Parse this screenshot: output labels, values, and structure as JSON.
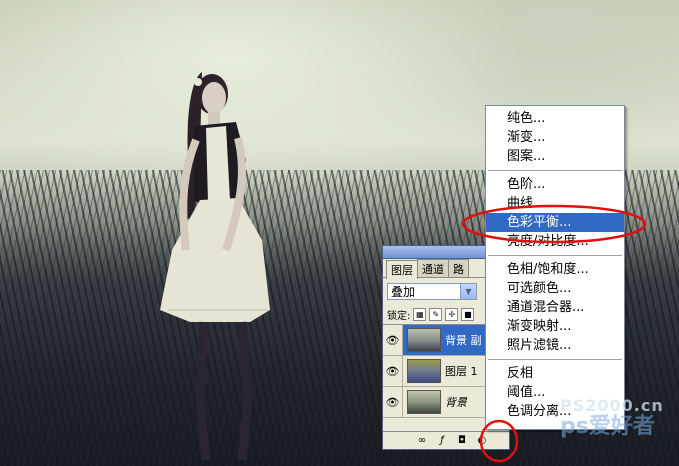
{
  "layers_panel": {
    "tabs": [
      "图层",
      "通道",
      "路"
    ],
    "blend_mode": "叠加",
    "lock_label": "锁定:",
    "layers": [
      {
        "name": "背景 副",
        "selected": true,
        "italic": false
      },
      {
        "name": "图层 1",
        "selected": false,
        "italic": false
      },
      {
        "name": "背景",
        "selected": false,
        "italic": true
      }
    ]
  },
  "adjustment_menu": {
    "groups": [
      [
        "纯色...",
        "渐变...",
        "图案..."
      ],
      [
        "色阶...",
        "曲线...",
        "色彩平衡...",
        "亮度/对比度..."
      ],
      [
        "色相/饱和度...",
        "可选颜色...",
        "通道混合器...",
        "渐变映射...",
        "照片滤镜..."
      ],
      [
        "反相",
        "阈值...",
        "色调分离..."
      ]
    ],
    "highlighted": "色彩平衡..."
  },
  "watermark": {
    "line1": "PS2000.cn",
    "line2": "ps爱好者"
  },
  "colors": {
    "highlight": "#316ac5",
    "annotation_red": "#e01010"
  }
}
